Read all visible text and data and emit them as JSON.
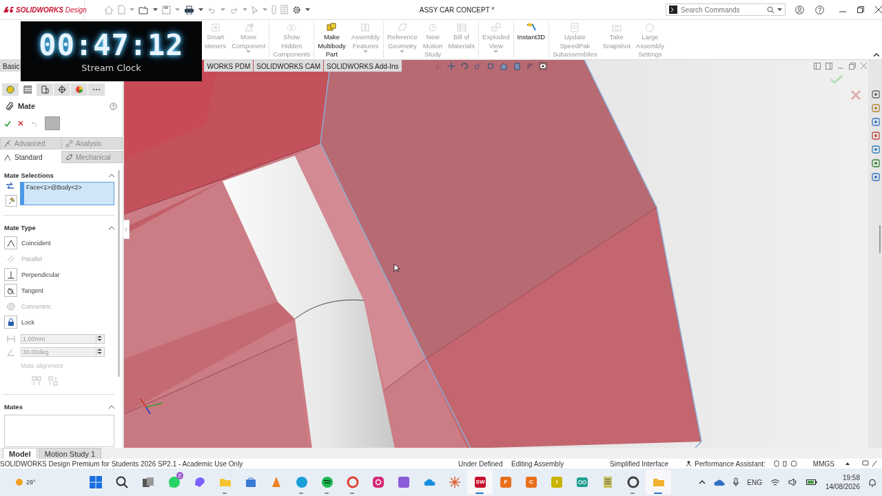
{
  "title_bar": {
    "app_name": "**SOLIDWORKS** Design",
    "document_title": "ASSY CAR CONCEPT *",
    "search": {
      "placeholder": "Search Commands"
    }
  },
  "ribbon": {
    "buttons": [
      {
        "label": "Smart\nsteners",
        "kind": "bolt",
        "disabled": true,
        "dropdown": false
      },
      {
        "label": "Move\nComponent",
        "kind": "move",
        "disabled": true,
        "dropdown": true
      },
      {
        "label": "Show\nHidden\nComponents",
        "kind": "eye",
        "disabled": true,
        "dropdown": false
      },
      {
        "label": "Make\nMultibody\nPart",
        "kind": "bodies",
        "disabled": false,
        "dropdown": false
      },
      {
        "label": "Assembly\nFeatures",
        "kind": "feature",
        "disabled": true,
        "dropdown": true
      },
      {
        "label": "Reference\nGeometry",
        "kind": "plane",
        "disabled": true,
        "dropdown": true
      },
      {
        "label": "New\nMotion\nStudy",
        "kind": "motion",
        "disabled": true,
        "dropdown": false
      },
      {
        "label": "Bill of\nMaterials",
        "kind": "table",
        "disabled": true,
        "dropdown": false
      },
      {
        "label": "Exploded\nView",
        "kind": "explode",
        "disabled": true,
        "dropdown": true
      },
      {
        "label": "Instant3D",
        "kind": "arrow",
        "disabled": false,
        "dropdown": false
      },
      {
        "label": "Update\nSpeedPak\nSubassemblies",
        "kind": "speedpak",
        "disabled": true,
        "dropdown": false
      },
      {
        "label": "Take\nSnapshot",
        "kind": "camera",
        "disabled": true,
        "dropdown": false
      },
      {
        "label": "Large\nAssembly\nSettings",
        "kind": "assembly",
        "disabled": true,
        "dropdown": false
      }
    ]
  },
  "command_tabs": [
    {
      "label": "Basic",
      "selected": false
    },
    {
      "label": "WORKS PDM",
      "selected": false
    },
    {
      "label": "SOLIDWORKS CAM",
      "selected": false
    },
    {
      "label": "SOLIDWORKS Add-Ins",
      "selected": false
    }
  ],
  "stream_clock": {
    "time": "00:47:12",
    "caption": "Stream Clock"
  },
  "property_manager": {
    "panel_tabs": [
      {
        "selected": false
      },
      {
        "selected": true
      },
      {
        "selected": false
      },
      {
        "selected": false
      },
      {
        "selected": false
      },
      {
        "selected": false
      }
    ],
    "title": "Mate",
    "mode_tabs": [
      {
        "label": "Advanced",
        "selected": false
      },
      {
        "label": "Analysis",
        "selected": false
      },
      {
        "label": "Standard",
        "selected": true
      },
      {
        "label": "Mechanical",
        "selected": false
      }
    ],
    "mate_selections": {
      "heading": "Mate Selections",
      "entries": [
        "Face<1>@Body<2>"
      ]
    },
    "mate_type": {
      "heading": "Mate Type",
      "types": [
        {
          "label": "Coincident",
          "kind": "coincident",
          "disabled": false
        },
        {
          "label": "Parallel",
          "kind": "parallel",
          "disabled": true
        },
        {
          "label": "Perpendicular",
          "kind": "perpendicular",
          "disabled": false
        },
        {
          "label": "Tangent",
          "kind": "tangent",
          "disabled": false
        },
        {
          "label": "Concentric",
          "kind": "concentric",
          "disabled": true
        },
        {
          "label": "Lock",
          "kind": "lock",
          "disabled": false
        }
      ],
      "distance": {
        "value": "1.00mm",
        "disabled": true
      },
      "angle": {
        "value": "30.00deg",
        "disabled": true
      },
      "alignment_label": "Mate alignment"
    },
    "mates": {
      "heading": "Mates"
    }
  },
  "bottom_tabs": [
    {
      "label": "Model",
      "selected": true
    },
    {
      "label": "Motion Study 1",
      "selected": false
    }
  ],
  "status_bar": {
    "product": "SOLIDWORKS Design Premium for Students 2026 SP2.1 - Academic Use Only",
    "definition": "Under Defined",
    "mode": "Editing Assembly",
    "interface": "Simplified Interface",
    "assistant": "Performance Assistant:",
    "units": "MMGS"
  },
  "taskbar": {
    "weather": "29°",
    "apps": [
      {
        "kind": "chat",
        "color": "#25d366",
        "badge": "2",
        "running": false,
        "active": false
      },
      {
        "kind": "swirl",
        "color": "#7b61ff",
        "running": false,
        "active": false
      },
      {
        "kind": "folder",
        "color": "#f4c430",
        "running": true,
        "active": false
      },
      {
        "kind": "bag",
        "color": "#3a7bd5",
        "running": false,
        "active": false
      },
      {
        "kind": "cone",
        "color": "#f08020",
        "running": false,
        "active": false
      },
      {
        "kind": "wave",
        "color": "#1a9ed8",
        "running": true,
        "active": false
      },
      {
        "kind": "disc",
        "color": "#1db954",
        "running": true,
        "active": false
      },
      {
        "kind": "ring",
        "color": "#e04030",
        "running": true,
        "active": false
      },
      {
        "kind": "camera",
        "color": "#d62976",
        "running": false,
        "active": false
      },
      {
        "kind": "tile",
        "color": "#8a5cd8",
        "running": false,
        "active": false
      },
      {
        "kind": "cloud",
        "color": "#1a8fe0",
        "running": false,
        "active": false
      },
      {
        "kind": "star",
        "color": "#e06030",
        "running": false,
        "active": false
      },
      {
        "kind": "tile",
        "color": "#c8102e",
        "text": "SW",
        "running": true,
        "active": true
      },
      {
        "kind": "tile",
        "color": "#e8701a",
        "text": "F",
        "running": false,
        "active": false
      },
      {
        "kind": "tile",
        "color": "#e8701a",
        "text": "C",
        "running": false,
        "active": false
      },
      {
        "kind": "tile",
        "color": "#c8b400",
        "text": "I",
        "running": false,
        "active": false
      },
      {
        "kind": "loop",
        "color": "#20a090",
        "running": false,
        "active": false
      },
      {
        "kind": "note",
        "color": "#c8c060",
        "running": false,
        "active": false
      },
      {
        "kind": "ring",
        "color": "#404040",
        "running": true,
        "active": false
      },
      {
        "kind": "folder",
        "color": "#f0b030",
        "running": true,
        "active": true
      }
    ],
    "language": "ENG",
    "time": "19:58",
    "date": "14/08/2026"
  }
}
